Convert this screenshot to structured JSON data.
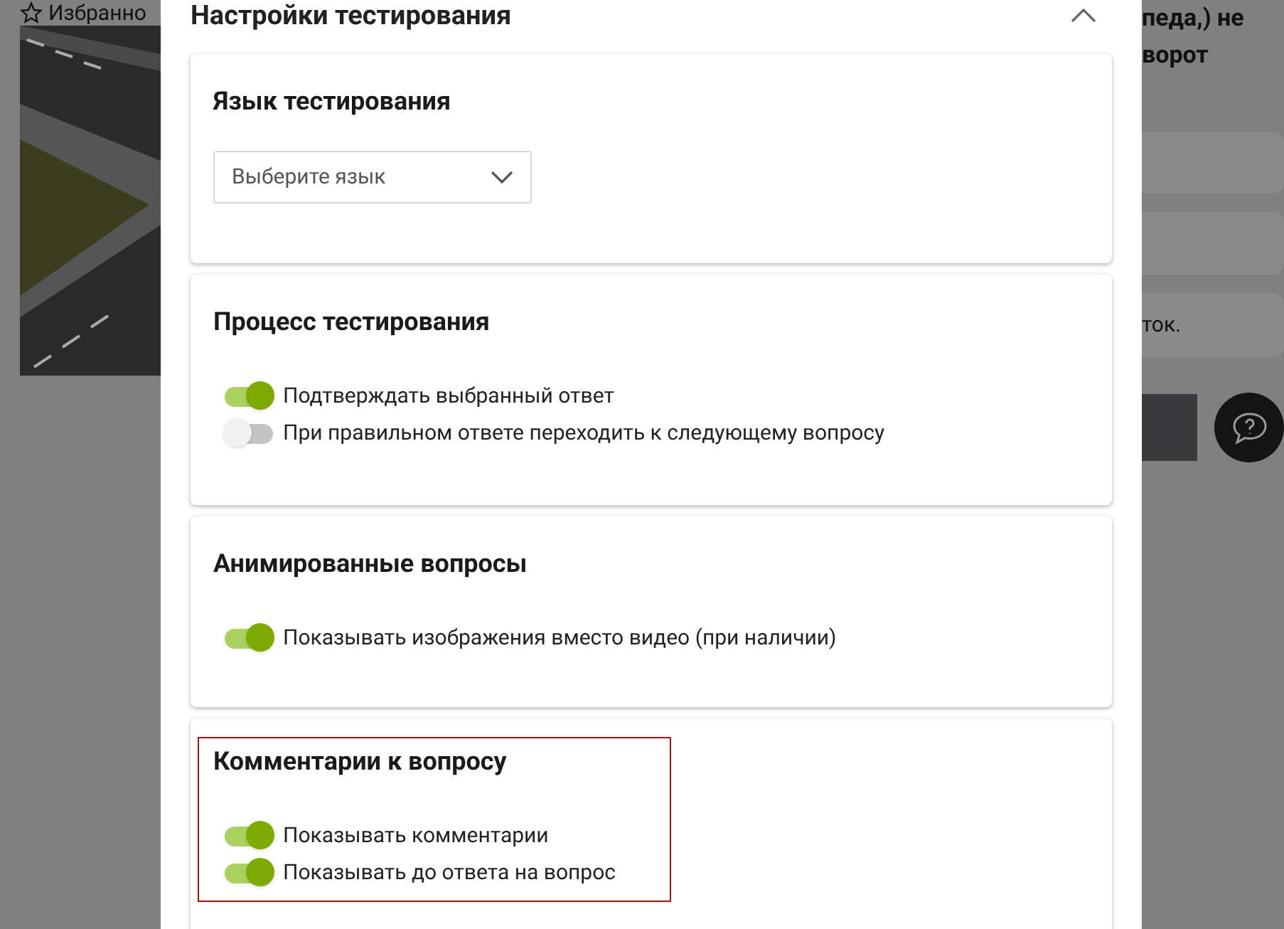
{
  "background": {
    "favorites_label": "Избранно",
    "question_lines": [
      "педа,) не",
      "ворот"
    ],
    "answers": [
      {
        "text": "ток."
      }
    ]
  },
  "modal": {
    "title": "Настройки тестирования",
    "sections": [
      {
        "kind": "select",
        "title": "Язык тестирования",
        "placeholder": "Выберите язык",
        "highlighted": false
      },
      {
        "kind": "toggles",
        "title": "Процесс тестирования",
        "highlighted": false,
        "options": [
          {
            "label": "Подтверждать выбранный ответ",
            "on": true
          },
          {
            "label": "При правильном ответе переходить к следующему вопросу",
            "on": false
          }
        ]
      },
      {
        "kind": "toggles",
        "title": "Анимированные вопросы",
        "highlighted": false,
        "options": [
          {
            "label": "Показывать изображения вместо видео (при наличии)",
            "on": true
          }
        ]
      },
      {
        "kind": "toggles",
        "title": "Комментарии к вопросу",
        "highlighted": true,
        "options": [
          {
            "label": "Показывать комментарии",
            "on": true
          },
          {
            "label": "Показывать до ответа на вопрос",
            "on": true
          }
        ]
      }
    ]
  }
}
